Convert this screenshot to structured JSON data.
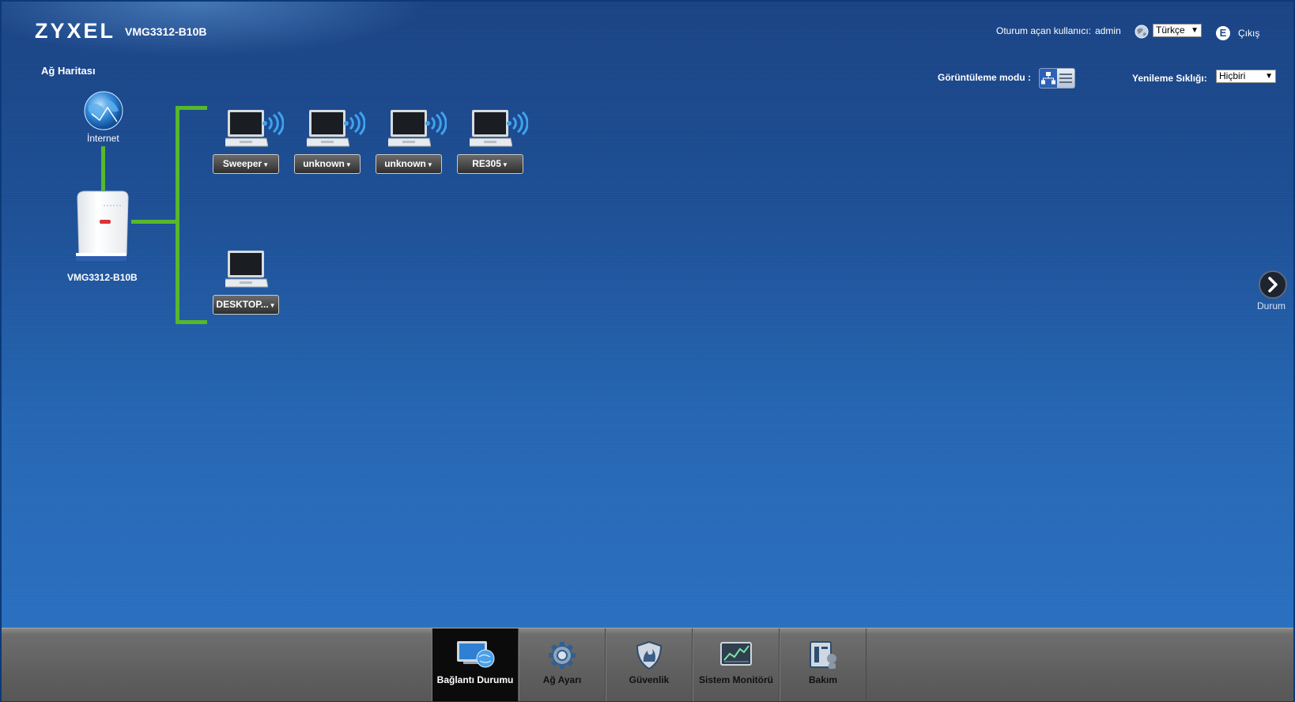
{
  "header": {
    "logo": "ZYXEL",
    "model": "VMG3312-B10B",
    "user_label": "Oturum açan kullanıcı:",
    "user_name": "admin",
    "language": "Türkçe",
    "logout_label": "Çıkış"
  },
  "page": {
    "title": "Ağ Haritası",
    "view_mode_label": "Görüntüleme modu :",
    "refresh_label": "Yenileme Sıklığı:",
    "refresh_value": "Hiçbiri"
  },
  "map": {
    "internet_label": "İnternet",
    "router_label": "VMG3312-B10B",
    "wireless_devices": [
      {
        "label": "Sweeper"
      },
      {
        "label": "unknown"
      },
      {
        "label": "unknown"
      },
      {
        "label": "RE305"
      }
    ],
    "wired_devices": [
      {
        "label": "DESKTOP..."
      }
    ]
  },
  "side": {
    "status_label": "Durum"
  },
  "nav": [
    {
      "label": "Bağlantı Durumu",
      "icon": "connection-status-icon",
      "active": true
    },
    {
      "label": "Ağ Ayarı",
      "icon": "gear-icon",
      "active": false
    },
    {
      "label": "Güvenlik",
      "icon": "shield-icon",
      "active": false
    },
    {
      "label": "Sistem Monitörü",
      "icon": "monitor-chart-icon",
      "active": false
    },
    {
      "label": "Bakım",
      "icon": "maintenance-icon",
      "active": false
    }
  ],
  "colors": {
    "link_line": "#57b82b",
    "background": "#1d4f95",
    "nav_bar": "#5f5f5f",
    "nav_active": "#0b0b0b"
  }
}
